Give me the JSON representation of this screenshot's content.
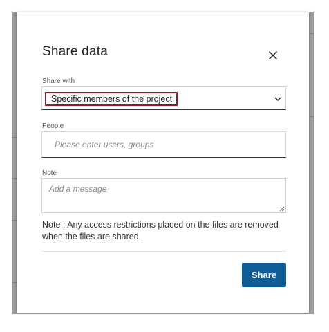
{
  "dialog": {
    "title": "Share data",
    "close_icon": "close-icon",
    "share_with": {
      "label": "Share with",
      "selected": "Specific members of the project",
      "chevron_icon": "chevron-down-icon"
    },
    "people": {
      "label": "People",
      "placeholder": "Please enter users, groups"
    },
    "note": {
      "label": "Note",
      "placeholder": "Add a message"
    },
    "disclaimer": "Note : Any access restrictions placed on the files are removed when the files are shared.",
    "share_button": "Share"
  },
  "colors": {
    "primary": "#0f5c97",
    "focus_outline": "#8b1d2c",
    "overlay": "#9a9a9a"
  }
}
